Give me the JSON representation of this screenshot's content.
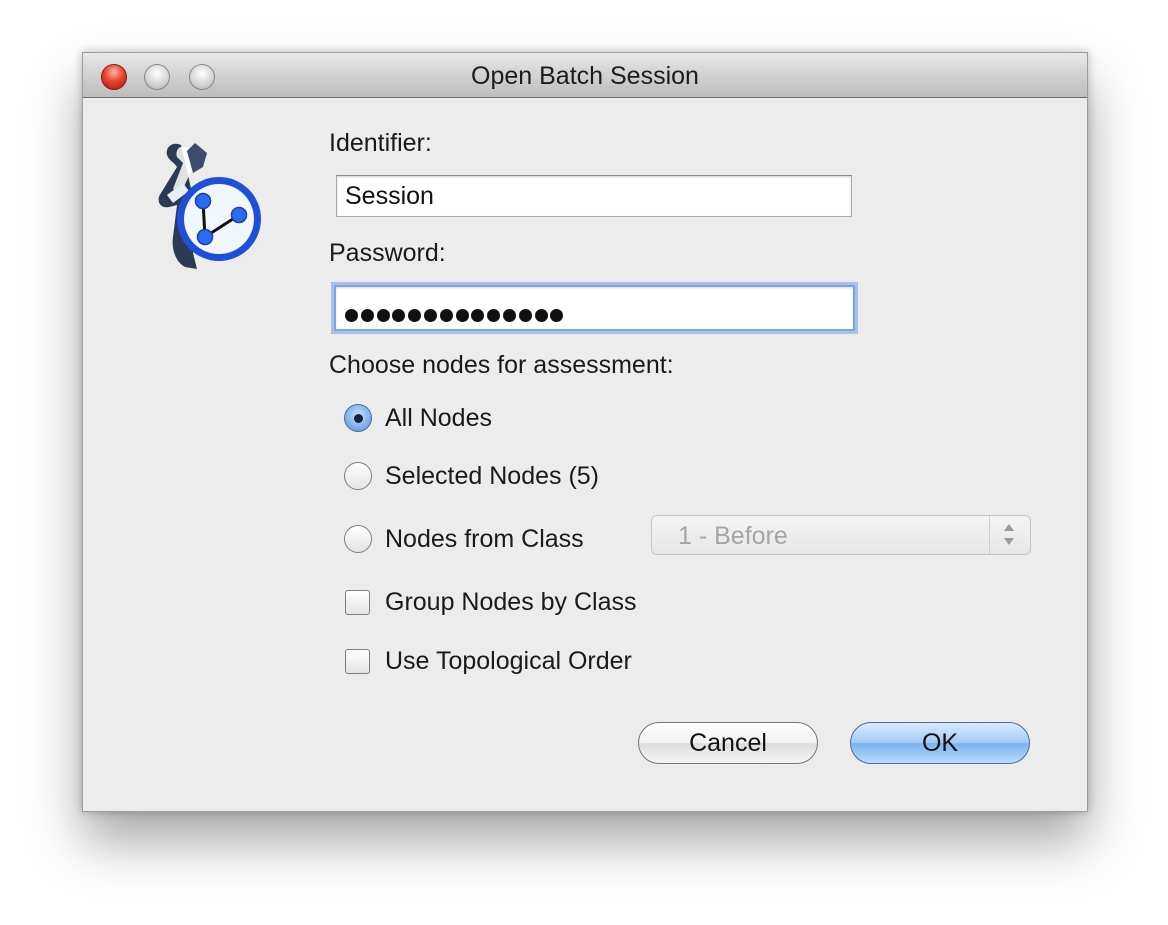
{
  "window": {
    "title": "Open Batch Session"
  },
  "form": {
    "identifier_label": "Identifier:",
    "identifier_value": "Session",
    "password_label": "Password:",
    "password_mask_count": 14,
    "nodes_label": "Choose nodes for assessment:"
  },
  "options": {
    "all_nodes": "All Nodes",
    "selected_nodes": "Selected Nodes (5)",
    "nodes_from_class": "Nodes from Class",
    "class_select_value": "1 - Before",
    "group_by_class": "Group Nodes by Class",
    "topological_order": "Use Topological Order",
    "selected_radio": "all_nodes"
  },
  "buttons": {
    "cancel": "Cancel",
    "ok": "OK"
  },
  "colors": {
    "window_bg": "#ececec",
    "focus_ring": "#7aa6e0",
    "default_button": "#7ab3ef",
    "logo_blue": "#1e4fd8"
  },
  "icons": {
    "app_logo": "batch-session-logo-icon"
  }
}
